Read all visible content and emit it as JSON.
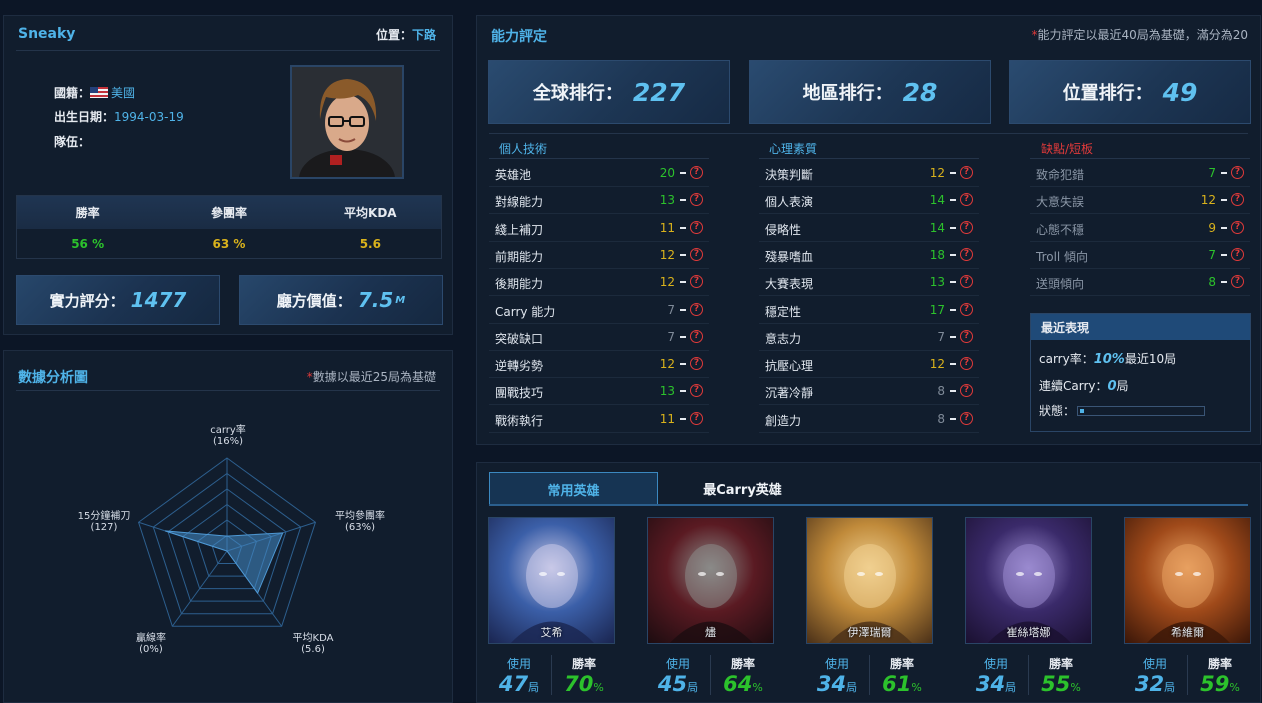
{
  "profile": {
    "name": "Sneaky",
    "position_label": "位置：",
    "position_value": "下路",
    "nationality_label": "國籍：",
    "nationality_value": "美國",
    "birth_label": "出生日期：",
    "birth_value": "1994-03-19",
    "team_label": "隊伍：",
    "stats_headers": [
      "勝率",
      "參團率",
      "平均KDA"
    ],
    "stats_values": [
      "56 %",
      "63 %",
      "5.6"
    ],
    "stats_colors": [
      "#2cc22c",
      "#d9b21c",
      "#d9b21c"
    ],
    "power_label": "實力評分：",
    "power_value": "1477",
    "worth_label": "廳方價值：",
    "worth_value": "7.5",
    "worth_unit": "M"
  },
  "radar": {
    "title": "數據分析圖",
    "note": "數據以最近25局為基礎",
    "axes": [
      {
        "label": "carry率",
        "value": "(16%)",
        "level": 0.16
      },
      {
        "label": "平均參團率",
        "value": "(63%)",
        "level": 0.63
      },
      {
        "label": "平均KDA",
        "value": "(5.6)",
        "level": 0.56
      },
      {
        "label": "贏線率",
        "value": "(0%)",
        "level": 0.0
      },
      {
        "label": "15分鐘補刀",
        "value": "(127)",
        "level": 0.7
      }
    ]
  },
  "ability": {
    "title": "能力評定",
    "note": "能力評定以最近40局為基礎，滿分為20",
    "ranks": [
      {
        "label": "全球排行：",
        "value": "227"
      },
      {
        "label": "地區排行：",
        "value": "28"
      },
      {
        "label": "位置排行：",
        "value": "49"
      }
    ],
    "columns": [
      {
        "title": "個人技術",
        "items": [
          {
            "name": "英雄池",
            "value": "20",
            "color": "#2cc22c"
          },
          {
            "name": "對線能力",
            "value": "13",
            "color": "#2cc22c"
          },
          {
            "name": "綫上補刀",
            "value": "11",
            "color": "#d9b21c"
          },
          {
            "name": "前期能力",
            "value": "12",
            "color": "#d9b21c"
          },
          {
            "name": "後期能力",
            "value": "12",
            "color": "#d9b21c"
          },
          {
            "name": "Carry 能力",
            "value": "7",
            "color": "#7f8a98"
          },
          {
            "name": "突破缺口",
            "value": "7",
            "color": "#7f8a98"
          },
          {
            "name": "逆轉劣勢",
            "value": "12",
            "color": "#d9b21c"
          },
          {
            "name": "團戰技巧",
            "value": "13",
            "color": "#2cc22c"
          },
          {
            "name": "戰術執行",
            "value": "11",
            "color": "#d9b21c"
          }
        ]
      },
      {
        "title": "心理素質",
        "items": [
          {
            "name": "決策判斷",
            "value": "12",
            "color": "#d9b21c"
          },
          {
            "name": "個人表演",
            "value": "14",
            "color": "#2cc22c"
          },
          {
            "name": "侵略性",
            "value": "14",
            "color": "#2cc22c"
          },
          {
            "name": "殘暴嗜血",
            "value": "18",
            "color": "#2cc22c"
          },
          {
            "name": "大賽表現",
            "value": "13",
            "color": "#2cc22c"
          },
          {
            "name": "穩定性",
            "value": "17",
            "color": "#2cc22c"
          },
          {
            "name": "意志力",
            "value": "7",
            "color": "#7f8a98"
          },
          {
            "name": "抗壓心理",
            "value": "12",
            "color": "#d9b21c"
          },
          {
            "name": "沉著冷靜",
            "value": "8",
            "color": "#7f8a98"
          },
          {
            "name": "創造力",
            "value": "8",
            "color": "#7f8a98"
          }
        ]
      },
      {
        "title": "缺點/短板",
        "items": [
          {
            "name": "致命犯錯",
            "value": "7",
            "color": "#2cc22c"
          },
          {
            "name": "大意失誤",
            "value": "12",
            "color": "#d9b21c"
          },
          {
            "name": "心態不穩",
            "value": "9",
            "color": "#d9b21c"
          },
          {
            "name": "Troll 傾向",
            "value": "7",
            "color": "#2cc22c"
          },
          {
            "name": "送頭傾向",
            "value": "8",
            "color": "#2cc22c"
          }
        ]
      }
    ],
    "recent": {
      "title": "最近表現",
      "carry_label": "carry率：",
      "carry_value": "10%",
      "carry_suffix": "最近10局",
      "streak_label": "連續Carry：",
      "streak_value": "0",
      "streak_suffix": "局",
      "state_label": "狀態：",
      "state_level": 0.03
    }
  },
  "heroes": {
    "tabs": [
      "常用英雄",
      "最Carry英雄"
    ],
    "use_label": "使用",
    "win_label": "勝率",
    "games_unit": "局",
    "pct_unit": "%",
    "list": [
      {
        "name": "艾希",
        "games": "47",
        "winrate": "70",
        "colors": [
          "#3b5fa8",
          "#c9c9e8",
          "#1a2550"
        ]
      },
      {
        "name": "燼",
        "games": "45",
        "winrate": "64",
        "colors": [
          "#5a1a22",
          "#8a8a88",
          "#1c0c10"
        ]
      },
      {
        "name": "伊澤瑞爾",
        "games": "34",
        "winrate": "61",
        "colors": [
          "#c08a3a",
          "#f0d090",
          "#4a3018"
        ]
      },
      {
        "name": "崔絲塔娜",
        "games": "34",
        "winrate": "55",
        "colors": [
          "#3a2a6a",
          "#9a8ad0",
          "#1a1030"
        ]
      },
      {
        "name": "希維爾",
        "games": "32",
        "winrate": "59",
        "colors": [
          "#a04a1a",
          "#e8a060",
          "#3a1608"
        ]
      }
    ]
  }
}
